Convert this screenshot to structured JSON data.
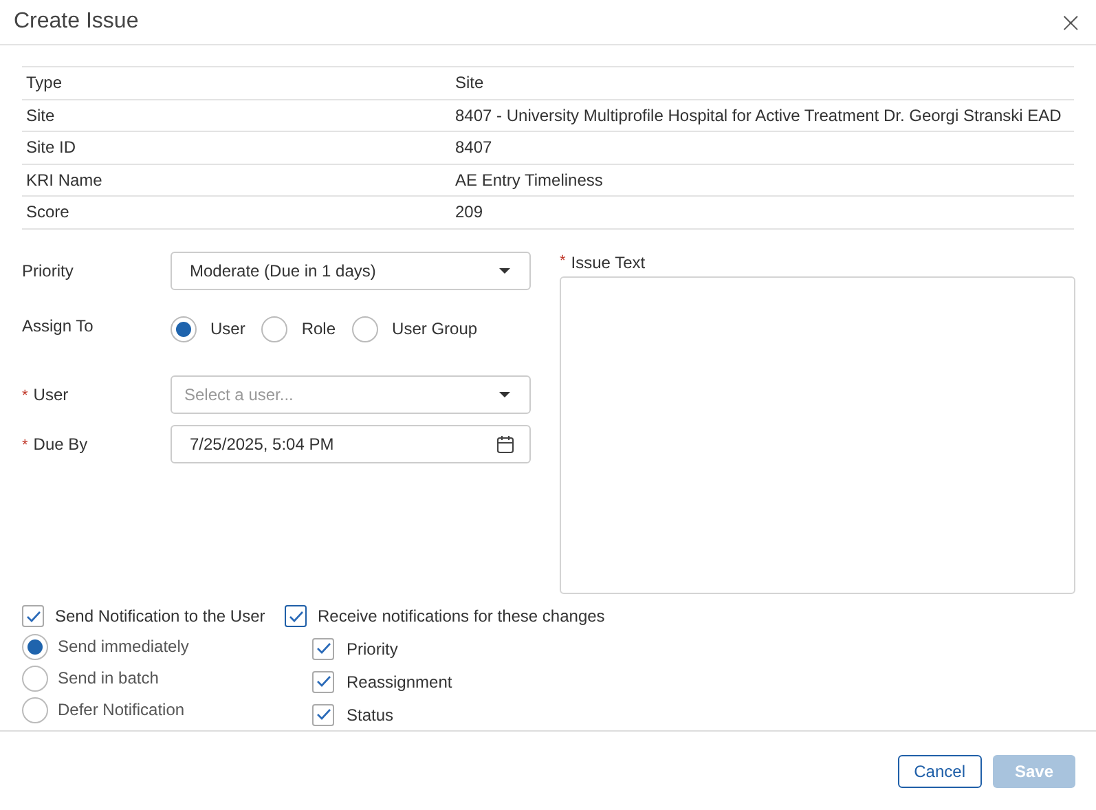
{
  "window": {
    "title": "Create Issue",
    "close": "×"
  },
  "details": [
    {
      "label": "Type",
      "value": "Site"
    },
    {
      "label": "Site",
      "value": "8407 - University Multiprofile Hospital for Active Treatment Dr. Georgi Stranski EAD"
    },
    {
      "label": "Site ID",
      "value": "8407"
    },
    {
      "label": "KRI Name",
      "value": "AE Entry Timeliness"
    },
    {
      "label": "Score",
      "value": "209"
    }
  ],
  "priority": {
    "label": "Priority",
    "value": "Moderate (Due in 1 days)"
  },
  "assign_to": {
    "label": "Assign To",
    "options": [
      {
        "label": "User",
        "selected": true
      },
      {
        "label": "Role",
        "selected": false
      },
      {
        "label": "User Group",
        "selected": false
      }
    ]
  },
  "user": {
    "label": "User",
    "marker": "*",
    "placeholder": "Select a user..."
  },
  "due_by": {
    "label": "Due By",
    "marker": "*",
    "value": "7/25/2025, 5:04 PM"
  },
  "issue_text": {
    "label": "Issue Text",
    "marker": "*"
  },
  "send_notification": {
    "label": "Send Notification to the User",
    "checked": true,
    "options": [
      {
        "label": "Send immediately",
        "selected": true
      },
      {
        "label": "Send in batch",
        "selected": false
      },
      {
        "label": "Defer Notification",
        "selected": false
      }
    ]
  },
  "receive_notifications": {
    "label": "Receive notifications for these changes",
    "checked": true,
    "items": [
      {
        "label": "Priority",
        "checked": true
      },
      {
        "label": "Reassignment",
        "checked": true
      },
      {
        "label": "Status",
        "checked": true
      }
    ]
  },
  "buttons": [
    {
      "label": "Cancel",
      "kind": "secondary",
      "disabled": false
    },
    {
      "label": "Save",
      "kind": "primary",
      "disabled": true
    }
  ]
}
